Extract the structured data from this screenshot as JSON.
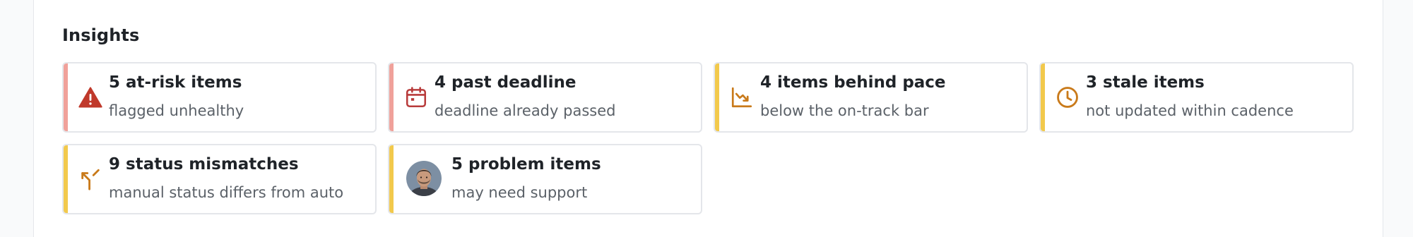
{
  "insights": {
    "title": "Insights",
    "cards": [
      {
        "title": "5 at-risk items",
        "subtitle": "flagged unhealthy",
        "icon": "warning-triangle-icon",
        "accent": "#f0a19a",
        "icon_color": "#c0392b"
      },
      {
        "title": "4 past deadline",
        "subtitle": "deadline already passed",
        "icon": "calendar-icon",
        "accent": "#f0a19a",
        "icon_color": "#b83b3b"
      },
      {
        "title": "4 items behind pace",
        "subtitle": "below the on-track bar",
        "icon": "trending-down-icon",
        "accent": "#f2c94c",
        "icon_color": "#c97a1a"
      },
      {
        "title": "3 stale items",
        "subtitle": "not updated within cadence",
        "icon": "clock-icon",
        "accent": "#f2c94c",
        "icon_color": "#c97a1a"
      },
      {
        "title": "9 status mismatches",
        "subtitle": "manual status differs from auto",
        "icon": "split-arrow-icon",
        "accent": "#f2c94c",
        "icon_color": "#c97a1a"
      },
      {
        "title": "5 problem items",
        "subtitle": "may need support",
        "icon": "avatar",
        "accent": "#f2c94c"
      }
    ]
  }
}
